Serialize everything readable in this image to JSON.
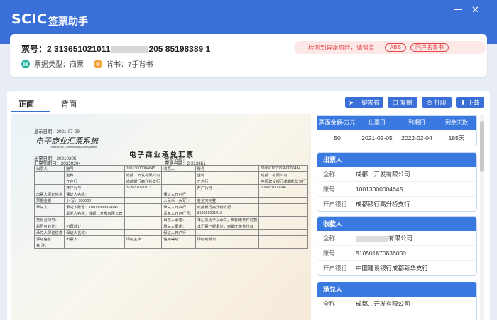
{
  "app": {
    "logo": "SCIC",
    "name": "签票助手"
  },
  "ticket": {
    "label": "票号：",
    "number_prefix": "2 313651021011",
    "number_suffix": "205 85198389 1",
    "type_label": "票据类型：商票",
    "endorse_label": "背书：7手背书",
    "type_icon": "bill-type-icon",
    "endorse_icon": "endorse-icon"
  },
  "warning": {
    "text": "检测到异常风险，请留意！",
    "tag_abb": "ABB",
    "tag_same_name": "同户名背书"
  },
  "tabs": {
    "front": "正面",
    "back": "背面"
  },
  "toolbar": {
    "publish": "一键发布",
    "copy": "复制",
    "print": "打印",
    "download": "下载"
  },
  "bill": {
    "date_line": "显示日期：2021-07-29",
    "logo_cn": "电子商业汇票系统",
    "logo_en": "Electronic Commercial Draft System",
    "title": "电子商业承兑汇票",
    "issue_date": "出票日期：20210205",
    "status": "票据状态：",
    "due_date": "汇票到期日：20220204",
    "bill_no": "票据号码：2 313651",
    "rows": [
      [
        "出票人",
        "账号",
        "10013000004645",
        "收票人",
        "账号",
        "5105018708360000434"
      ],
      [
        "",
        "全称",
        "成都…开发有限公司",
        "",
        "全称",
        "成都…有限公司"
      ],
      [
        "",
        "开户行",
        "成都银行高升桥支行",
        "",
        "开户行",
        "中国建设银行成都新华支行"
      ],
      [
        "",
        "开户行号",
        "313651021013",
        "",
        "开户行号",
        "105651000604"
      ],
      [
        "出票人保证信息",
        "保证人名称：",
        "",
        "保证人开户行：",
        "",
        ""
      ],
      [
        "票据金额",
        "小  写：300000",
        "",
        "人民币（大写）：",
        "叁拾万元整",
        ""
      ],
      [
        "承兑人",
        "承兑人账号：10013000004645",
        "",
        "承兑人开户行：",
        "成都银行高升桥支行",
        ""
      ],
      [
        "",
        "承兑人名称：成都…开发有限公司",
        "",
        "承兑人开户行号：",
        "313651021013",
        ""
      ],
      [
        "交易合同号：",
        "",
        "",
        "出票人承诺：",
        "本汇票请予以承兑，到期无条件付款",
        ""
      ],
      [
        "是否可转让：",
        "可再转让",
        "",
        "承兑人承诺：",
        "本汇票已经承兑，到期无条件付款",
        ""
      ],
      [
        "承兑人保证信息",
        "保证人名称：",
        "",
        "保证人开户行：",
        "",
        ""
      ],
      [
        "评级信息",
        "出票人：",
        "评级主体：",
        "信用等级：",
        "评级到期日：",
        ""
      ],
      [
        "备  注：",
        "",
        "",
        "",
        "",
        ""
      ]
    ]
  },
  "stats": {
    "headers": [
      "票面金额-万元",
      "出票日",
      "到期日",
      "剩余天数"
    ],
    "values": [
      "50",
      "2021-02-05",
      "2022-02-04",
      "185天"
    ]
  },
  "drawer": {
    "title": "出票人",
    "full_name_label": "全称",
    "full_name": "成都…开发有限公司",
    "account_label": "账号",
    "account": "10013000004645",
    "bank_label": "开户银行",
    "bank": "成都银行高升桥支行"
  },
  "payee": {
    "title": "收款人",
    "full_name_label": "全称",
    "full_name": "有限公司",
    "account_label": "账号",
    "account": "510501870836000",
    "bank_label": "开户银行",
    "bank": "中国建设银行成都新华支行"
  },
  "acceptor": {
    "title": "承兑人",
    "full_name_label": "全称",
    "full_name": "成都…开发有限公司"
  },
  "colors": {
    "brand": "#3a6fd8",
    "header_blue": "#3a7ae0",
    "warn": "#e54848"
  }
}
